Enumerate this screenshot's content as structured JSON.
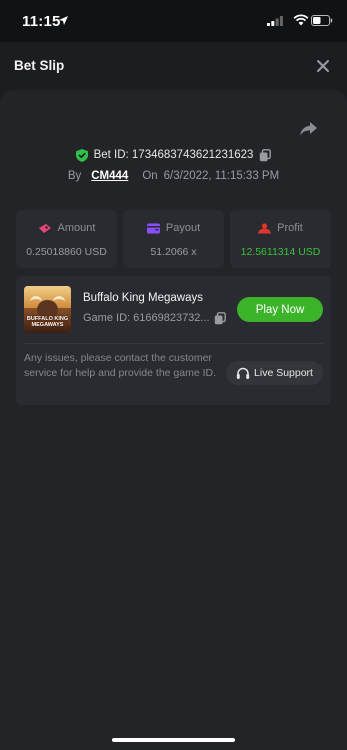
{
  "status_bar": {
    "time": "11:15"
  },
  "header": {
    "title": "Bet Slip"
  },
  "bet": {
    "id_text": "Bet ID: 1734683743621231623",
    "by_label": "By",
    "user": "CM444",
    "on_label": "On",
    "datetime": "6/3/2022, 11:15:33 PM"
  },
  "stats": [
    {
      "label": "Amount",
      "value": "0.25018860 USD",
      "icon": "amount-icon",
      "color": "#e8457a"
    },
    {
      "label": "Payout",
      "value": "51.2066 x",
      "icon": "wallet-icon",
      "color": "#8a4dff"
    },
    {
      "label": "Profit",
      "value": "12.5611314 USD",
      "icon": "profit-icon",
      "color": "#e0342c"
    }
  ],
  "game": {
    "thumbnail_text": "BUFFALO KING MEGAWAYS",
    "name": "Buffalo King Megaways",
    "id_text": "Game ID: 61669823732...",
    "play_label": "Play Now",
    "help_text": "Any issues, please contact the customer service for help and provide the game ID.",
    "support_label": "Live Support"
  },
  "colors": {
    "accent_green": "#3cb42a",
    "profit_green": "#38c138",
    "sheet_bg": "#1c1d20",
    "card_bg": "#232428"
  }
}
